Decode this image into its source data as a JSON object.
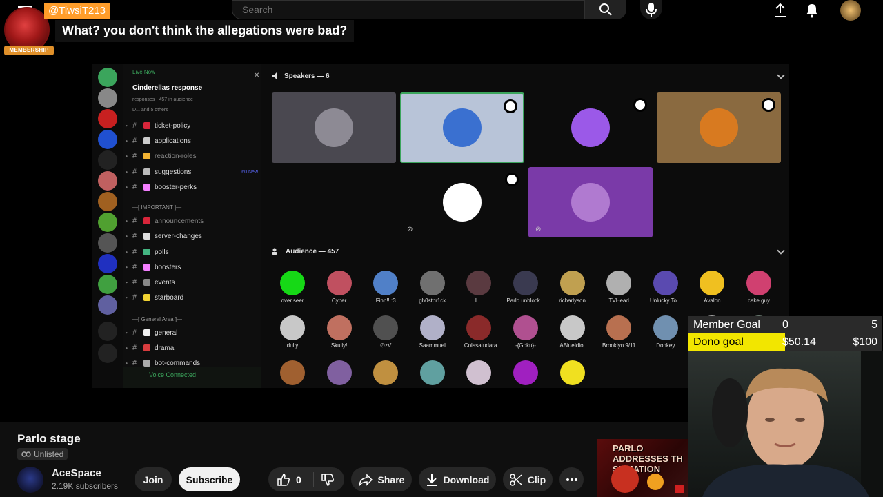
{
  "youtube": {
    "search_placeholder": "Search",
    "video_title": "Parlo stage",
    "visibility": "Unlisted",
    "channel_name": "AceSpace",
    "subscribers": "2.19K subscribers",
    "join_label": "Join",
    "subscribe_label": "Subscribe",
    "like_count": "0",
    "share_label": "Share",
    "download_label": "Download",
    "clip_label": "Clip"
  },
  "chat": {
    "username": "@TiwsiT213",
    "message": "What? you don't think the allegations were bad?",
    "badge": "MEMBERSHIP"
  },
  "discord": {
    "live_label": "Live Now",
    "live_title": "Cinderellas response",
    "live_sub1": "responses · 457 in audience",
    "live_sub2": "D... and 5 others",
    "channels": [
      {
        "name": "ticket-policy",
        "dim": false,
        "emoji": "#d8253a"
      },
      {
        "name": "applications",
        "dim": false,
        "emoji": "#cccccc"
      },
      {
        "name": "reaction-roles",
        "dim": true,
        "emoji": "#f0b232"
      },
      {
        "name": "suggestions",
        "dim": false,
        "emoji": "#bbbbbb",
        "badge": "60 New"
      },
      {
        "name": "booster-perks",
        "dim": false,
        "emoji": "#f47fff"
      },
      {
        "name": "announcements",
        "dim": true,
        "emoji": "#d8253a"
      },
      {
        "name": "server-changes",
        "dim": false,
        "emoji": "#dddddd"
      },
      {
        "name": "polls",
        "dim": false,
        "emoji": "#43b581"
      },
      {
        "name": "boosters",
        "dim": false,
        "emoji": "#f47fff"
      },
      {
        "name": "events",
        "dim": false,
        "emoji": "#888888"
      },
      {
        "name": "starboard",
        "dim": false,
        "emoji": "#f0d232"
      },
      {
        "name": "general",
        "dim": false,
        "emoji": "#eeeeee"
      },
      {
        "name": "drama",
        "dim": false,
        "emoji": "#d83c3e"
      },
      {
        "name": "bot-commands",
        "dim": false,
        "emoji": "#aaaaaa"
      }
    ],
    "category_important": "IMPORTANT",
    "category_general": "General Area",
    "voice_connected": "Voice Connected",
    "speakers_heading": "Speakers — 6",
    "audience_heading": "Audience — 457",
    "speaker_tiles": [
      {
        "bg": "#4a4850",
        "av": "#8d8a94",
        "mod": false
      },
      {
        "bg": "#b8c4d8",
        "av": "#3a70d0",
        "mod": true
      },
      {
        "bg": "#0c0c0c",
        "av": "#9b59e8",
        "mod": true
      },
      {
        "bg": "#8a6a40",
        "av": "#d87a20",
        "mod": true
      },
      {
        "bg": "#0c0c0c",
        "av": "#ffffff",
        "mod": true
      },
      {
        "bg": "#7a3aa8",
        "av": "#b07ad0",
        "mod": false
      }
    ],
    "audience": [
      {
        "name": "over.seer",
        "color": "#16d916"
      },
      {
        "name": "Cyber",
        "color": "#c05060"
      },
      {
        "name": "Finn!! :3",
        "color": "#5080c8"
      },
      {
        "name": "gh0stbr1ck",
        "color": "#707070"
      },
      {
        "name": "L...",
        "color": "#5a3a40"
      },
      {
        "name": "Parlo unblock...",
        "color": "#3a3a50"
      },
      {
        "name": "richarlyson",
        "color": "#c0a050"
      },
      {
        "name": "TVHead",
        "color": "#b0b0b0"
      },
      {
        "name": "Unlucky To...",
        "color": "#5a4ab0"
      },
      {
        "name": "Avalon",
        "color": "#f0c020"
      },
      {
        "name": "cake guy",
        "color": "#d04070"
      },
      {
        "name": "dully",
        "color": "#c8c8c8"
      },
      {
        "name": "Skully!",
        "color": "#c07060"
      },
      {
        "name": "∅zV",
        "color": "#505050"
      },
      {
        "name": "Saammuel",
        "color": "#b0b0c8"
      },
      {
        "name": "! Colasatudara",
        "color": "#8a2a2a"
      },
      {
        "name": "-{Goku}-",
        "color": "#b05090"
      },
      {
        "name": "ABlueIdiot",
        "color": "#c8c8c8"
      },
      {
        "name": "Brooklyn 9/11",
        "color": "#b87050"
      },
      {
        "name": "Donkey",
        "color": "#7090b0"
      },
      {
        "name": "",
        "color": "#a0a0a0"
      },
      {
        "name": "",
        "color": "#6a7a70"
      },
      {
        "name": "",
        "color": "#a06030"
      },
      {
        "name": "",
        "color": "#8060a0"
      },
      {
        "name": "",
        "color": "#c09040"
      },
      {
        "name": "",
        "color": "#60a0a0"
      },
      {
        "name": "",
        "color": "#d0c0d0"
      },
      {
        "name": "",
        "color": "#a020c0"
      },
      {
        "name": "",
        "color": "#f0e020"
      }
    ]
  },
  "goals": {
    "member_label": "Member Goal",
    "member_current": "0",
    "member_target": "5",
    "member_progress": 0,
    "dono_label": "Dono goal",
    "dono_current": "$50.14",
    "dono_target": "$100",
    "dono_progress": 0.5014
  },
  "promo": {
    "text": "PARLO ADDRESSES TH SITUATION"
  },
  "colors": {
    "accent_orange": "#ff9d2a",
    "goal_yellow": "#f2e600",
    "discord_green": "#3ba55c"
  }
}
